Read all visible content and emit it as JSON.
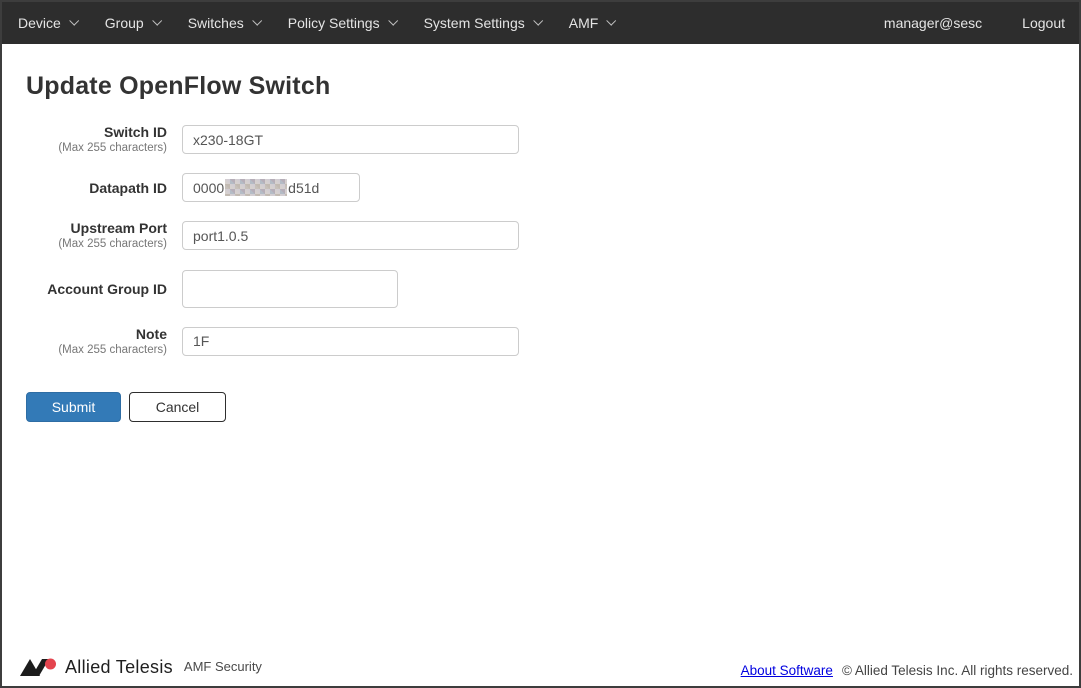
{
  "navbar": {
    "items": [
      {
        "label": "Device"
      },
      {
        "label": "Group"
      },
      {
        "label": "Switches"
      },
      {
        "label": "Policy Settings"
      },
      {
        "label": "System Settings"
      },
      {
        "label": "AMF"
      }
    ],
    "user": "manager@sesc",
    "logout_label": "Logout"
  },
  "page": {
    "title": "Update OpenFlow Switch"
  },
  "form": {
    "fields": [
      {
        "label": "Switch ID",
        "hint": "(Max 255 characters)",
        "value": "x230-18GT"
      },
      {
        "label": "Datapath ID",
        "hint": "",
        "value_prefix": "0000",
        "value_suffix": "d51d",
        "redacted": true
      },
      {
        "label": "Upstream Port",
        "hint": "(Max 255 characters)",
        "value": "port1.0.5"
      },
      {
        "label": "Account Group ID",
        "hint": "",
        "value": ""
      },
      {
        "label": "Note",
        "hint": "(Max 255 characters)",
        "value": "1F"
      }
    ],
    "submit_label": "Submit",
    "cancel_label": "Cancel"
  },
  "footer": {
    "brand": "Allied Telesis",
    "product": "AMF Security",
    "about_link": "About Software",
    "copyright": "© Allied Telesis Inc. All rights reserved."
  },
  "colors": {
    "navbar_bg": "#2d2d2d",
    "submit_blue": "#337ab7",
    "link_blue": "#0000e0",
    "brand_red": "#e4444e",
    "title_text": "#333333"
  }
}
